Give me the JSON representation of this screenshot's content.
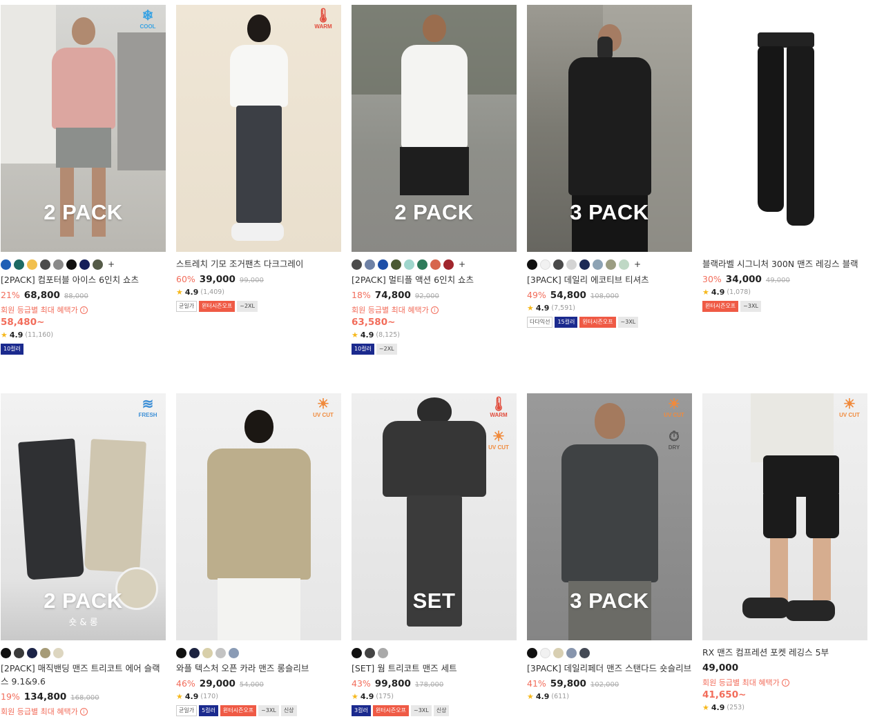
{
  "products": [
    {
      "name": "[2PACK] 컴포터블 아이스 6인치 쇼츠",
      "overlay": "2 PACK",
      "badges": [
        {
          "label": "COOL",
          "icon": "snowflake-icon",
          "glyph": "❄",
          "color": "#3aa3e3"
        }
      ],
      "swatches": [
        "#1f5fb5",
        "#1d6a63",
        "#f2c04e",
        "#4b4b4b",
        "#8a8a8a",
        "#111111",
        "#151f5a",
        "#555b48"
      ],
      "has_more_colors": true,
      "discount": "21%",
      "price": "68,800",
      "original": "88,000",
      "member_text": "회원 등급별 최대 혜택가",
      "member_price": "58,480~",
      "rating": "4.9",
      "reviews": "(11,160)",
      "tags": [
        {
          "text": "10컬러",
          "style": "navy"
        }
      ]
    },
    {
      "name": "스트레치 기모 조거팬츠 다크그레이",
      "overlay": "",
      "badges": [
        {
          "label": "WARM",
          "icon": "thermometer-icon",
          "glyph": "🌡",
          "color": "#e14d3d"
        }
      ],
      "swatches": [],
      "has_more_colors": false,
      "discount": "60%",
      "price": "39,000",
      "original": "99,000",
      "member_text": "",
      "member_price": "",
      "rating": "4.9",
      "reviews": "(1,409)",
      "tags": [
        {
          "text": "균일가",
          "style": "plain"
        },
        {
          "text": "윈터시즌오프",
          "style": "red"
        },
        {
          "text": "~2XL",
          "style": "gray"
        }
      ]
    },
    {
      "name": "[2PACK] 멀티플 액션 6인치 쇼츠",
      "overlay": "2 PACK",
      "badges": [],
      "swatches": [
        "#4c4c4c",
        "#6f82a6",
        "#1e4fa8",
        "#4a5a33",
        "#9fd6cc",
        "#2e7b5a",
        "#d7664d",
        "#a1262d"
      ],
      "has_more_colors": true,
      "discount": "18%",
      "price": "74,800",
      "original": "92,000",
      "member_text": "회원 등급별 최대 혜택가",
      "member_price": "63,580~",
      "rating": "4.9",
      "reviews": "(8,125)",
      "tags": [
        {
          "text": "10컬러",
          "style": "navy"
        },
        {
          "text": "~2XL",
          "style": "gray"
        }
      ]
    },
    {
      "name": "[3PACK] 데일리 에코티브 티셔츠",
      "overlay": "3 PACK",
      "badges": [],
      "swatches": [
        "#111111",
        "#f1f1f1",
        "#4a4a4a",
        "#d4d4d4",
        "#1c2a55",
        "#8da3b4",
        "#9b9d82",
        "#bfd8c5"
      ],
      "has_more_colors": true,
      "discount": "49%",
      "price": "54,800",
      "original": "108,000",
      "member_text": "",
      "member_price": "",
      "rating": "4.9",
      "reviews": "(7,591)",
      "tags": [
        {
          "text": "다다익선",
          "style": "plain"
        },
        {
          "text": "15컬러",
          "style": "navy"
        },
        {
          "text": "윈터시즌오프",
          "style": "red"
        },
        {
          "text": "~3XL",
          "style": "gray"
        }
      ]
    },
    {
      "name": "블랙라벨 시그니처 300N 맨즈 레깅스 블랙",
      "overlay": "",
      "badges": [],
      "swatches": [],
      "has_more_colors": false,
      "discount": "30%",
      "price": "34,000",
      "original": "49,000",
      "member_text": "",
      "member_price": "",
      "rating": "4.9",
      "reviews": "(1,078)",
      "tags": [
        {
          "text": "윈터시즌오프",
          "style": "red"
        },
        {
          "text": "~3XL",
          "style": "gray"
        }
      ]
    },
    {
      "name": "[2PACK] 매직밴딩 맨즈 트리코트 에어 슬랙스 9.1&9.6",
      "overlay": "2 PACK",
      "overlay_sub": "숏 & 롱",
      "badges": [
        {
          "label": "FRESH",
          "icon": "wind-icon",
          "glyph": "≋",
          "color": "#3d8fd6"
        }
      ],
      "swatches": [
        "#111111",
        "#3a3a3a",
        "#1b2347",
        "#a69b77",
        "#ddd6c0"
      ],
      "has_more_colors": false,
      "discount": "19%",
      "price": "134,800",
      "original": "168,000",
      "member_text": "회원 등급별 최대 혜택가",
      "member_price": "",
      "rating": "",
      "reviews": "",
      "tags": []
    },
    {
      "name": "와플 텍스처 오픈 카라 맨즈 롱슬리브",
      "overlay": "",
      "badges": [
        {
          "label": "UV CUT",
          "icon": "sun-icon",
          "glyph": "☀",
          "color": "#f08a3c"
        }
      ],
      "swatches": [
        "#111111",
        "#1c2340",
        "#d8cfa9",
        "#c3c3c3",
        "#8a9bb5"
      ],
      "has_more_colors": false,
      "discount": "46%",
      "price": "29,000",
      "original": "54,000",
      "member_text": "",
      "member_price": "",
      "rating": "4.9",
      "reviews": "(170)",
      "tags": [
        {
          "text": "균일가",
          "style": "plain"
        },
        {
          "text": "5컬러",
          "style": "navy"
        },
        {
          "text": "윈터시즌오프",
          "style": "red"
        },
        {
          "text": "~3XL",
          "style": "gray"
        },
        {
          "text": "신상",
          "style": "gray"
        }
      ]
    },
    {
      "name": "[SET] 웜 트리코트 맨즈 세트",
      "overlay": "SET",
      "badges": [
        {
          "label": "WARM",
          "icon": "thermometer-icon",
          "glyph": "🌡",
          "color": "#e14d3d"
        },
        {
          "label": "UV CUT",
          "icon": "sun-icon",
          "glyph": "☀",
          "color": "#f08a3c"
        }
      ],
      "swatches": [
        "#111111",
        "#444444",
        "#a9a9a9"
      ],
      "has_more_colors": false,
      "discount": "43%",
      "price": "99,800",
      "original": "178,000",
      "member_text": "",
      "member_price": "",
      "rating": "4.9",
      "reviews": "(175)",
      "tags": [
        {
          "text": "3컬러",
          "style": "navy"
        },
        {
          "text": "윈터시즌오프",
          "style": "red"
        },
        {
          "text": "~3XL",
          "style": "gray"
        },
        {
          "text": "신상",
          "style": "gray"
        }
      ]
    },
    {
      "name": "[3PACK] 데일리페더 맨즈 스탠다드 숏슬리브",
      "overlay": "3 PACK",
      "badges": [
        {
          "label": "UV CUT",
          "icon": "sun-icon",
          "glyph": "☀",
          "color": "#f08a3c"
        },
        {
          "label": "DRY",
          "icon": "stopwatch-icon",
          "glyph": "⏱",
          "color": "#555555"
        }
      ],
      "swatches": [
        "#111111",
        "#f1f1f1",
        "#d8cfb2",
        "#8795ad",
        "#444a55"
      ],
      "has_more_colors": false,
      "discount": "41%",
      "price": "59,800",
      "original": "102,000",
      "member_text": "",
      "member_price": "",
      "rating": "4.9",
      "reviews": "(611)",
      "tags": []
    },
    {
      "name": "RX 맨즈 컴프레션 포켓 레깅스 5부",
      "overlay": "",
      "badges": [
        {
          "label": "UV CUT",
          "icon": "sun-icon",
          "glyph": "☀",
          "color": "#f08a3c"
        }
      ],
      "swatches": [],
      "has_more_colors": false,
      "discount": "",
      "price": "49,000",
      "original": "",
      "member_text": "회원 등급별 최대 혜택가",
      "member_price": "41,650~",
      "rating": "4.9",
      "reviews": "(253)",
      "tags": []
    }
  ]
}
